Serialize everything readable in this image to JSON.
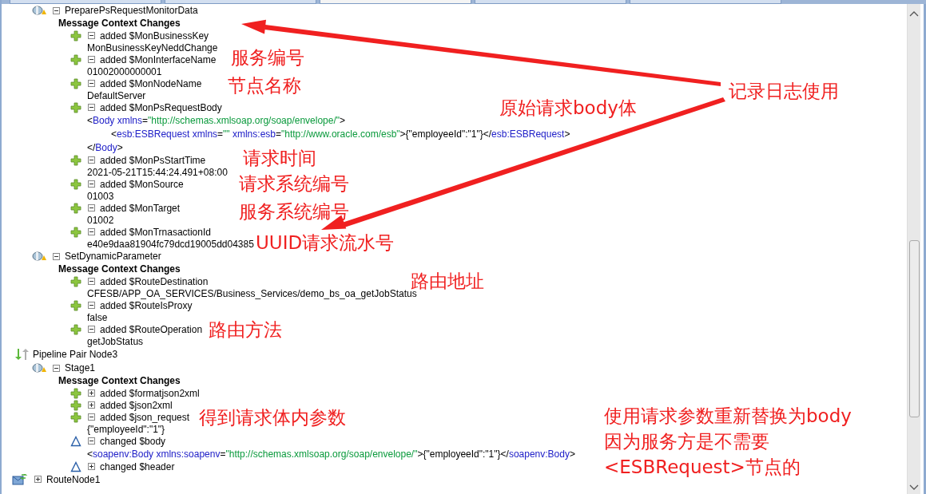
{
  "tabs": [
    {
      "selected": false
    },
    {
      "selected": false
    },
    {
      "selected": true
    },
    {
      "selected": false
    },
    {
      "selected": false
    }
  ],
  "tree": [
    {
      "kind": "stage",
      "label": "PreparePsRequestMonitorData",
      "expanded": true,
      "heading": "Message Context Changes",
      "changes": [
        {
          "kind": "added",
          "label": "added $MonBusinessKey",
          "expanded": true,
          "value": "MonBusinessKeyNeddChange"
        },
        {
          "kind": "added",
          "label": "added $MonInterfaceName",
          "expanded": true,
          "value": "01002000000001"
        },
        {
          "kind": "added",
          "label": "added $MonNodeName",
          "expanded": true,
          "value": "DefaultServer"
        },
        {
          "kind": "added",
          "label": "added $MonPsRequestBody",
          "expanded": true,
          "xml": [
            {
              "indent": false,
              "parts": [
                {
                  "kind": "punct",
                  "text": "<"
                },
                {
                  "kind": "tag",
                  "text": "Body"
                },
                {
                  "kind": "attr",
                  "text": " xmlns"
                },
                {
                  "kind": "punct",
                  "text": "="
                },
                {
                  "kind": "string",
                  "text": "\"http://schemas.xmlsoap.org/soap/envelope/\""
                },
                {
                  "kind": "punct",
                  "text": ">"
                }
              ]
            },
            {
              "indent": true,
              "parts": [
                {
                  "kind": "punct",
                  "text": "<"
                },
                {
                  "kind": "tag",
                  "text": "esb:ESBRequest"
                },
                {
                  "kind": "attr",
                  "text": " xmlns"
                },
                {
                  "kind": "punct",
                  "text": "="
                },
                {
                  "kind": "string",
                  "text": "\"\""
                },
                {
                  "kind": "attr",
                  "text": " xmlns:esb"
                },
                {
                  "kind": "punct",
                  "text": "="
                },
                {
                  "kind": "string",
                  "text": "\"http://www.oracle.com/esb\""
                },
                {
                  "kind": "punct",
                  "text": ">{\"employeeId\":\"1\"}</"
                },
                {
                  "kind": "tag",
                  "text": "esb:ESBRequest"
                },
                {
                  "kind": "punct",
                  "text": ">"
                }
              ]
            },
            {
              "indent": false,
              "parts": [
                {
                  "kind": "punct",
                  "text": "</"
                },
                {
                  "kind": "tag",
                  "text": "Body"
                },
                {
                  "kind": "punct",
                  "text": ">"
                }
              ]
            }
          ]
        },
        {
          "kind": "added",
          "label": "added $MonPsStartTime",
          "expanded": true,
          "value": "2021-05-21T15:44:24.491+08:00"
        },
        {
          "kind": "added",
          "label": "added $MonSource",
          "expanded": true,
          "value": "01003"
        },
        {
          "kind": "added",
          "label": "added $MonTarget",
          "expanded": true,
          "value": "01002"
        },
        {
          "kind": "added",
          "label": "added $MonTrnasactionId",
          "expanded": true,
          "value": "e40e9daa81904fc79dcd19005dd04385"
        }
      ]
    },
    {
      "kind": "stage",
      "label": "SetDynamicParameter",
      "expanded": true,
      "heading": "Message Context Changes",
      "changes": [
        {
          "kind": "added",
          "label": "added $RouteDestination",
          "expanded": true,
          "value": "CFESB/APP_OA_SERVICES/Business_Services/demo_bs_oa_getJobStatus"
        },
        {
          "kind": "added",
          "label": "added $RouteIsProxy",
          "expanded": true,
          "value": "false"
        },
        {
          "kind": "added",
          "label": "added $RouteOperation",
          "expanded": true,
          "value": "getJobStatus"
        }
      ]
    },
    {
      "kind": "pipeline",
      "label": "Pipeline Pair Node3",
      "children": [
        {
          "kind": "stage",
          "label": "Stage1",
          "expanded": true,
          "heading": "Message Context Changes",
          "changes": [
            {
              "kind": "added",
              "label": "added $formatjson2xml",
              "expanded": false
            },
            {
              "kind": "added",
              "label": "added $json2xml",
              "expanded": false
            },
            {
              "kind": "added",
              "label": "added $json_request",
              "expanded": true,
              "value": "{\"employeeId\":\"1\"}"
            },
            {
              "kind": "changed",
              "label": "changed $body",
              "expanded": true,
              "xml": [
                {
                  "indent": false,
                  "parts": [
                    {
                      "kind": "punct",
                      "text": "<"
                    },
                    {
                      "kind": "tag",
                      "text": "soapenv:Body"
                    },
                    {
                      "kind": "attr",
                      "text": " xmlns:soapenv"
                    },
                    {
                      "kind": "punct",
                      "text": "="
                    },
                    {
                      "kind": "string",
                      "text": "\"http://schemas.xmlsoap.org/soap/envelope/\""
                    },
                    {
                      "kind": "punct",
                      "text": ">{\"employeeId\":\"1\"}</"
                    },
                    {
                      "kind": "tag",
                      "text": "soapenv:Body"
                    },
                    {
                      "kind": "punct",
                      "text": ">"
                    }
                  ]
                }
              ]
            },
            {
              "kind": "changed",
              "label": "changed $header",
              "expanded": false
            }
          ]
        }
      ]
    },
    {
      "kind": "route",
      "label": "RouteNode1",
      "expanded": false
    }
  ],
  "annotations": [
    {
      "text": "服务编号"
    },
    {
      "text": "节点名称"
    },
    {
      "text": "原始请求body体"
    },
    {
      "text": "记录日志使用"
    },
    {
      "text": "请求时间"
    },
    {
      "text": "请求系统编号"
    },
    {
      "text": "服务系统编号"
    },
    {
      "text": "UUID请求流水号"
    },
    {
      "text": "路由地址"
    },
    {
      "text": "路由方法"
    },
    {
      "text": "得到请求体内参数"
    },
    {
      "text": "使用请求参数重新替换为body"
    },
    {
      "text": "因为服务方是不需要"
    },
    {
      "text": "<ESBRequest>节点的"
    }
  ]
}
